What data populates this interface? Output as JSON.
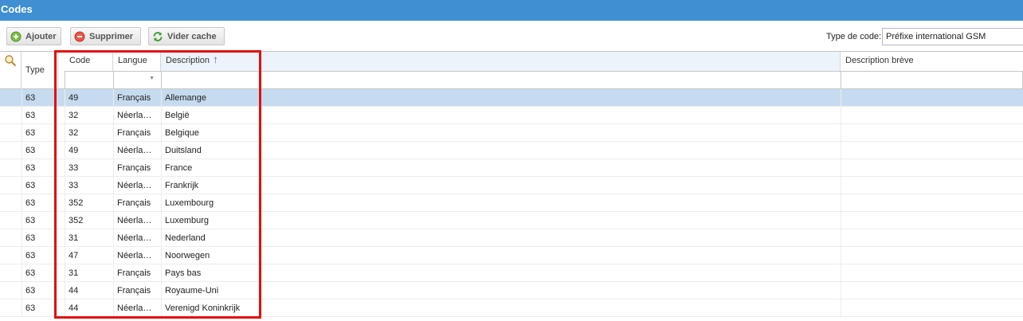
{
  "window": {
    "title": "Codes"
  },
  "toolbar": {
    "add_label": "Ajouter",
    "delete_label": "Supprimer",
    "clear_cache_label": "Vider cache",
    "code_type_label": "Type de code:",
    "code_type_value": "Préfixe international GSM"
  },
  "grid": {
    "columns": {
      "type": "Type",
      "code": "Code",
      "langue": "Langue",
      "description": "Description",
      "description_sort": "🠕",
      "description_breve": "Description brève"
    },
    "filters": {
      "langue_dropdown": "▼"
    },
    "rows": [
      {
        "type": "63",
        "code": "49",
        "langue": "Français",
        "description": "Allemange",
        "description_breve": ""
      },
      {
        "type": "63",
        "code": "32",
        "langue": "Néerla…",
        "description": "België",
        "description_breve": ""
      },
      {
        "type": "63",
        "code": "32",
        "langue": "Français",
        "description": "Belgique",
        "description_breve": ""
      },
      {
        "type": "63",
        "code": "49",
        "langue": "Néerla…",
        "description": "Duitsland",
        "description_breve": ""
      },
      {
        "type": "63",
        "code": "33",
        "langue": "Français",
        "description": "France",
        "description_breve": ""
      },
      {
        "type": "63",
        "code": "33",
        "langue": "Néerla…",
        "description": "Frankrijk",
        "description_breve": ""
      },
      {
        "type": "63",
        "code": "352",
        "langue": "Français",
        "description": "Luxembourg",
        "description_breve": ""
      },
      {
        "type": "63",
        "code": "352",
        "langue": "Néerla…",
        "description": "Luxemburg",
        "description_breve": ""
      },
      {
        "type": "63",
        "code": "31",
        "langue": "Néerla…",
        "description": "Nederland",
        "description_breve": ""
      },
      {
        "type": "63",
        "code": "47",
        "langue": "Néerla…",
        "description": "Noorwegen",
        "description_breve": ""
      },
      {
        "type": "63",
        "code": "31",
        "langue": "Français",
        "description": "Pays bas",
        "description_breve": ""
      },
      {
        "type": "63",
        "code": "44",
        "langue": "Français",
        "description": "Royaume-Uni",
        "description_breve": ""
      },
      {
        "type": "63",
        "code": "44",
        "langue": "Néerla…",
        "description": "Verenigd Koninkrijk",
        "description_breve": ""
      }
    ]
  },
  "colors": {
    "title_bar": "#3f8fd2",
    "selected_row": "#c6dbef",
    "highlight_box": "#e01010"
  }
}
